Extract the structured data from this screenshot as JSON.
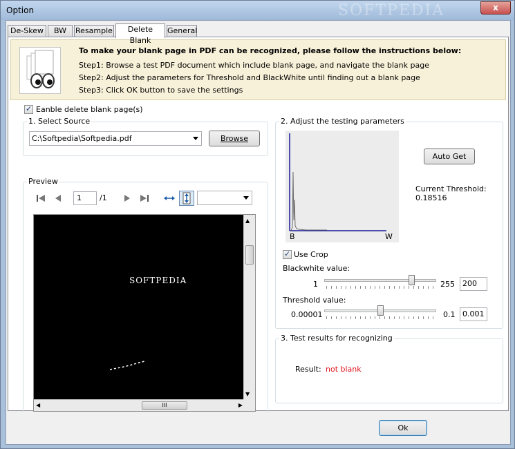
{
  "window": {
    "title": "Option",
    "watermark": "SOFTPEDIA",
    "close_glyph": "x"
  },
  "tabs": [
    {
      "label": "De-Skew",
      "active": false
    },
    {
      "label": "BW",
      "active": false
    },
    {
      "label": "Resample",
      "active": false
    },
    {
      "label": "Delete Blank",
      "active": true
    },
    {
      "label": "General",
      "active": false
    }
  ],
  "instructions": {
    "title": "To make your blank page in PDF can be recognized, please follow the instructions below:",
    "step1": "Step1: Browse a test PDF document which include blank page, and navigate the blank page",
    "step2": "Step2: Adjust the parameters for Threshold and BlackWhite until finding out a blank page",
    "step3": "Step3: Click OK button to save the settings"
  },
  "enable_delete": {
    "label": "Eanble delete blank page(s)",
    "checked": true
  },
  "select_source": {
    "title": "1. Select Source",
    "file_path": "C:\\Softpedia\\Softpedia.pdf",
    "browse_label": "Browse"
  },
  "preview": {
    "title": "Preview",
    "current_page": "1",
    "total_pages": "/1",
    "zoom_value": "",
    "preview_text": "SOFTPEDIA",
    "hscroll_grip": "III"
  },
  "testing": {
    "title": "2. Adjust the testing parameters",
    "axis_b": "B",
    "axis_w": "W",
    "auto_get_label": "Auto Get",
    "current_threshold_label": "Current Threshold:",
    "current_threshold_value": "0.18516",
    "use_crop_label": "Use Crop",
    "use_crop_checked": true,
    "blackwhite_label": "Blackwhite  value:",
    "blackwhite_min": "1",
    "blackwhite_max": "255",
    "blackwhite_value": "200",
    "blackwhite_fraction": 0.78,
    "threshold_label": "Threshold value:",
    "threshold_min": "0.00001",
    "threshold_max": "0.1",
    "threshold_value": "0.001",
    "threshold_fraction": 0.5
  },
  "results": {
    "title": "3. Test results for recognizing",
    "result_label": "Result:",
    "result_value": "not blank",
    "result_color": "#e0141e"
  },
  "footer": {
    "ok_label": "Ok"
  },
  "icons": [
    "close-icon",
    "document-search-icon",
    "first-page-icon",
    "previous-page-icon",
    "next-page-icon",
    "last-page-icon",
    "fit-width-icon",
    "fit-height-icon",
    "chevron-down-icon"
  ]
}
